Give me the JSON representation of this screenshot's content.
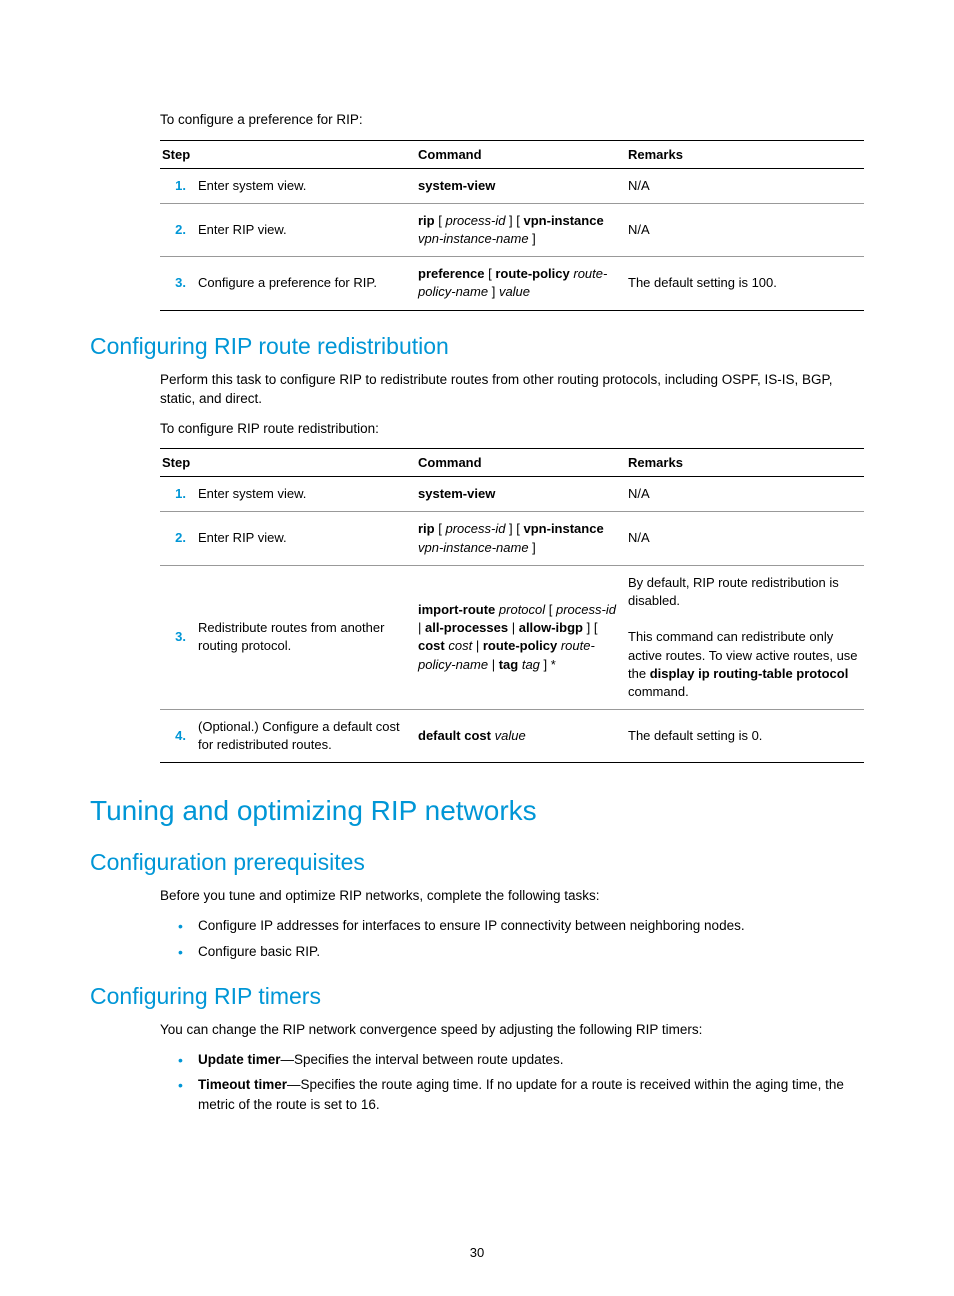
{
  "intro_text": "To configure a preference for RIP:",
  "table1": {
    "headers": {
      "step": "Step",
      "command": "Command",
      "remarks": "Remarks"
    },
    "rows": [
      {
        "num": "1.",
        "step": "Enter system view.",
        "cmd_html": "<b>system-view</b>",
        "remarks": "N/A"
      },
      {
        "num": "2.",
        "step": "Enter RIP view.",
        "cmd_html": "<b>rip</b> [ <span class='italic'>process-id</span> ] [ <b>vpn-instance</b> <span class='italic'>vpn-instance-name</span> ]",
        "remarks": "N/A"
      },
      {
        "num": "3.",
        "step": "Configure a preference for RIP.",
        "cmd_html": "<b>preference</b> [ <b>route-policy</b> <span class='italic'>route-policy-name</span> ] <span class='italic'>value</span>",
        "remarks": "The default setting is 100."
      }
    ]
  },
  "h2_redistribution": "Configuring RIP route redistribution",
  "redistribution_p1": "Perform this task to configure RIP to redistribute routes from other routing protocols, including OSPF, IS-IS, BGP, static, and direct.",
  "redistribution_p2": "To configure RIP route redistribution:",
  "table2": {
    "headers": {
      "step": "Step",
      "command": "Command",
      "remarks": "Remarks"
    },
    "rows": [
      {
        "num": "1.",
        "step": "Enter system view.",
        "cmd_html": "<b>system-view</b>",
        "remarks_html": "N/A"
      },
      {
        "num": "2.",
        "step": "Enter RIP view.",
        "cmd_html": "<b>rip</b> [ <span class='italic'>process-id</span> ] [ <b>vpn-instance</b> <span class='italic'>vpn-instance-name</span> ]",
        "remarks_html": "N/A"
      },
      {
        "num": "3.",
        "step": "Redistribute routes from another routing protocol.",
        "cmd_html": "<b>import-route</b> <span class='italic'>protocol</span> [ <span class='italic'>process-id</span> | <b>all-processes</b> | <b>allow-ibgp</b> ] [ <b>cost</b> <span class='italic'>cost</span> | <b>route-policy</b> <span class='italic'>route-policy-name</span> | <b>tag</b> <span class='italic'>tag</span> ] *",
        "remarks_html": "By default, RIP route redistribution is disabled.<br><br>This command can redistribute only active routes. To view active routes, use the <b>display ip routing-table protocol</b> command."
      },
      {
        "num": "4.",
        "step": "(Optional.) Configure a default cost for redistributed routes.",
        "cmd_html": "<b>default cost</b> <span class='italic'>value</span>",
        "remarks_html": "The default setting is 0."
      }
    ]
  },
  "h1_tuning": "Tuning and optimizing RIP networks",
  "h2_prereq": "Configuration prerequisites",
  "prereq_p": "Before you tune and optimize RIP networks, complete the following tasks:",
  "prereq_bullets": [
    "Configure IP addresses for interfaces to ensure IP connectivity between neighboring nodes.",
    "Configure basic RIP."
  ],
  "h2_timers": "Configuring RIP timers",
  "timers_p": "You can change the RIP network convergence speed by adjusting the following RIP timers:",
  "timers_bullets": [
    {
      "term": "Update timer",
      "rest": "—Specifies the interval between route updates."
    },
    {
      "term": "Timeout timer",
      "rest": "—Specifies the route aging time. If no update for a route is received within the aging time, the metric of the route is set to 16."
    }
  ],
  "page_num": "30"
}
